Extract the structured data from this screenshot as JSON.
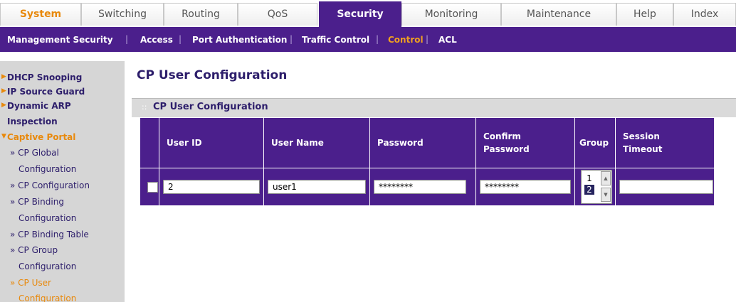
{
  "tabs": [
    "System",
    "Switching",
    "Routing",
    "QoS",
    "Security",
    "Monitoring",
    "Maintenance",
    "Help",
    "Index"
  ],
  "subnav": [
    "Management Security",
    "Access",
    "Port Authentication",
    "Traffic Control",
    "Control",
    "ACL"
  ],
  "sidebar": {
    "items": [
      "DHCP Snooping",
      "IP Source Guard",
      "Dynamic ARP",
      "Inspection",
      "Captive Portal"
    ],
    "sub": [
      "» CP Global",
      "Configuration",
      "» CP Configuration",
      "» CP Binding",
      "Configuration",
      "» CP Binding Table",
      "» CP Group",
      "Configuration",
      "» CP User",
      "Configuration"
    ]
  },
  "page": {
    "title": "CP User Configuration"
  },
  "panel": {
    "title": "CP User Configuration"
  },
  "table": {
    "headers": [
      "User ID",
      "User Name",
      "Password",
      "Confirm",
      "Password",
      "Group",
      "Session",
      "Timeout"
    ],
    "row": {
      "user_id": "2",
      "user_name": "user1",
      "password": "********",
      "confirm": "********",
      "group_options": [
        "1",
        "2"
      ],
      "session_timeout": ""
    }
  },
  "colors": {
    "primary": "#4b1f8c",
    "accent": "#e8890c",
    "nav_bg": "#d6d6d6"
  }
}
